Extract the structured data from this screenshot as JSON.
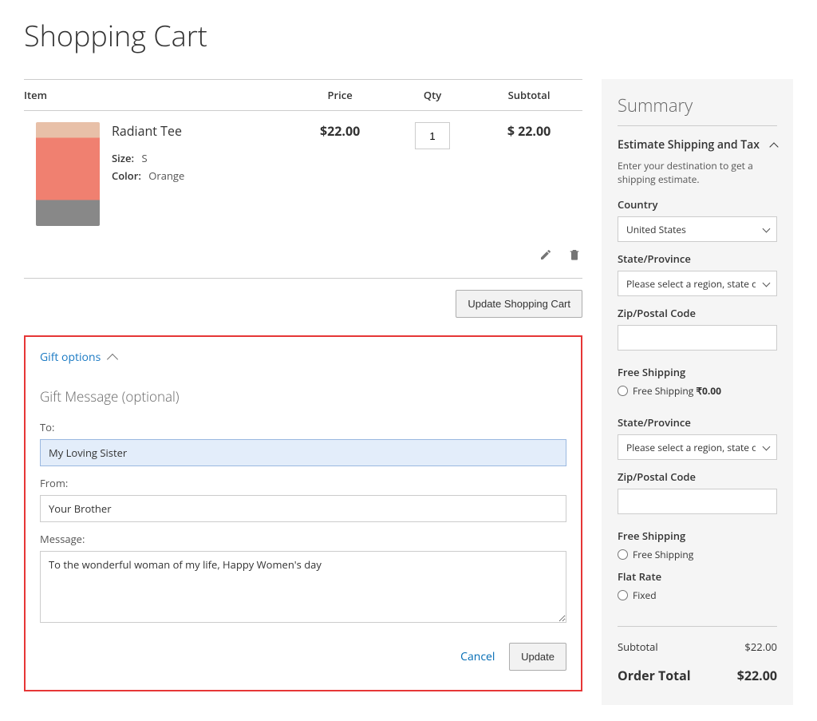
{
  "page": {
    "title": "Shopping Cart"
  },
  "headers": {
    "item": "Item",
    "price": "Price",
    "qty": "Qty",
    "subtotal": "Subtotal"
  },
  "item": {
    "name": "Radiant Tee",
    "size_label": "Size:",
    "size_value": "S",
    "color_label": "Color:",
    "color_value": "Orange",
    "price": "$22.00",
    "qty": "1",
    "subtotal": "$ 22.00"
  },
  "buttons": {
    "updateCart": "Update Shopping Cart",
    "cancel": "Cancel",
    "update": "Update"
  },
  "gift": {
    "toggle": "Gift options",
    "heading": "Gift Message (optional)",
    "to_label": "To:",
    "to_value": "My Loving Sister",
    "from_label": "From:",
    "from_value": "Your Brother",
    "message_label": "Message:",
    "message_value": "To the wonderful woman of my life, Happy Women's day"
  },
  "summary": {
    "title": "Summary",
    "estimate_title": "Estimate Shipping and Tax",
    "estimate_desc": "Enter your destination to get a shipping estimate.",
    "country_label": "Country",
    "country_value": "United States",
    "state_label": "State/Province",
    "state_placeholder": "Please select a region, state or province",
    "zip_label": "Zip/Postal Code",
    "shipping": {
      "free_title": "Free Shipping",
      "free_option": "Free Shipping ",
      "free_price": "₹0.00",
      "state_label2": "State/Province",
      "zip_label2": "Zip/Postal Code",
      "flat_title": "Flat Rate",
      "flat_option": "Fixed"
    },
    "subtotal_label": "Subtotal",
    "subtotal_value": "$22.00",
    "order_total_label": "Order Total",
    "order_total_value": "$22.00"
  }
}
